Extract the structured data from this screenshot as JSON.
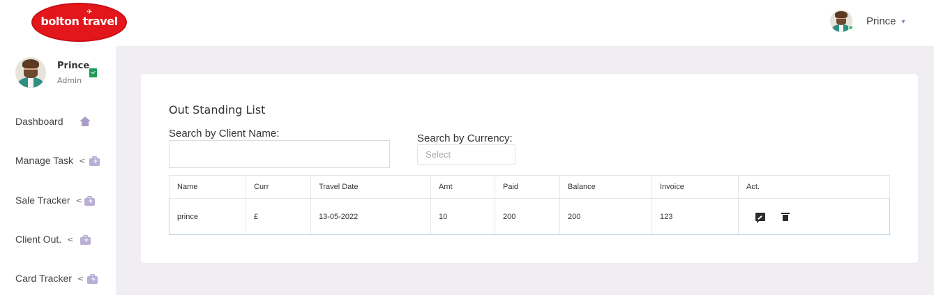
{
  "brand": {
    "logo_text": "bolton travel"
  },
  "header": {
    "user_name": "Prince"
  },
  "sidebar": {
    "user": {
      "name": "Prince",
      "role": "Admin"
    },
    "items": [
      {
        "label": "Dashboard",
        "icon": "home-icon",
        "has_chevron": false
      },
      {
        "label": "Manage Task",
        "icon": "briefcase-icon",
        "has_chevron": true
      },
      {
        "label": "Sale Tracker",
        "icon": "briefcase-icon",
        "has_chevron": true
      },
      {
        "label": "Client Out.",
        "icon": "briefcase-icon",
        "has_chevron": true
      },
      {
        "label": "Card Tracker",
        "icon": "briefcase-icon",
        "has_chevron": true
      }
    ]
  },
  "main": {
    "title": "Out Standing List",
    "search_client_label": "Search by Client Name:",
    "search_client_value": "",
    "search_currency_label": "Search by Currency:",
    "search_currency_placeholder": "Select",
    "table": {
      "columns": [
        "Name",
        "Curr",
        "Travel Date",
        "Amt",
        "Paid",
        "Balance",
        "Invoice",
        "Act."
      ],
      "rows": [
        {
          "name": "prince",
          "curr": "£",
          "travel_date": "13-05-2022",
          "amt": "10",
          "paid": "200",
          "balance": "200",
          "invoice": "123"
        }
      ]
    }
  },
  "colors": {
    "brand_red": "#e3161b",
    "sidebar_icon": "#b9aed3",
    "verified_green": "#1f9b57",
    "online_green": "#2ecc71",
    "main_bg": "#f1eef3",
    "row_border": "#b9d3e3"
  }
}
